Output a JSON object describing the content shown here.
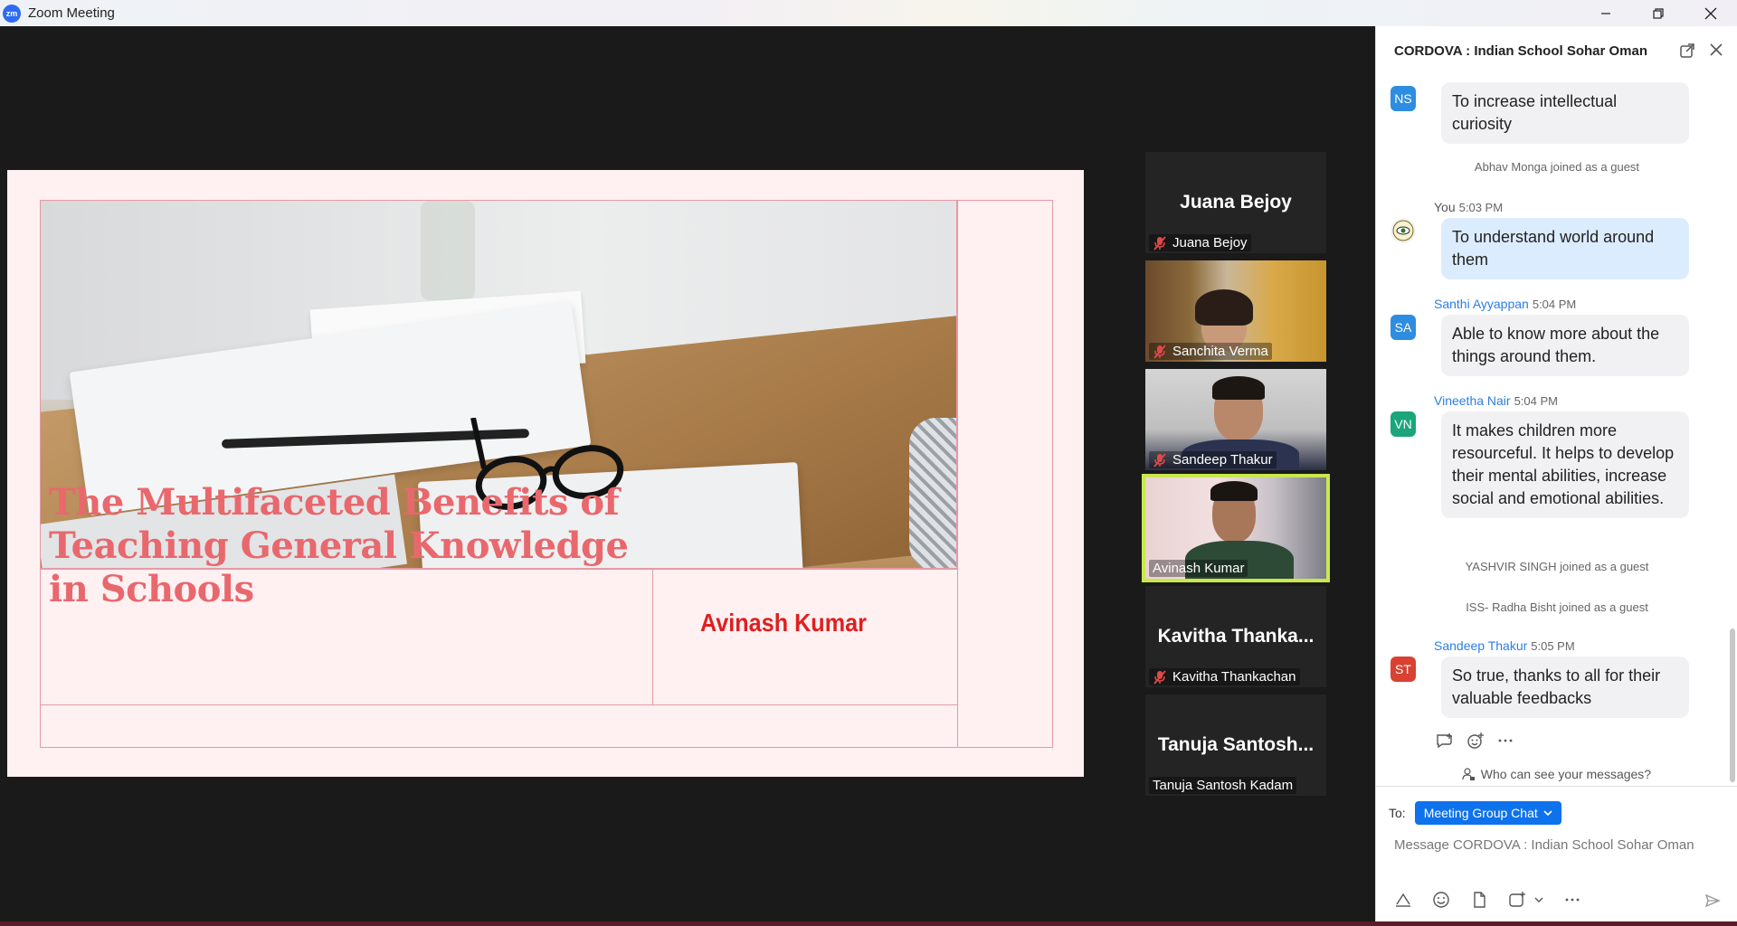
{
  "window": {
    "title": "Zoom Meeting",
    "logo_text": "zm"
  },
  "slide": {
    "title": "The Multifaceted Benefits of Teaching General Knowledge in Schools",
    "author": "Avinash Kumar"
  },
  "participants": [
    {
      "big_name": "Juana Bejoy",
      "label": "Juana Bejoy",
      "muted": true,
      "video": false
    },
    {
      "big_name": "",
      "label": "Sanchita Verma",
      "muted": true,
      "video": true
    },
    {
      "big_name": "",
      "label": "Sandeep Thakur",
      "muted": true,
      "video": true
    },
    {
      "big_name": "",
      "label": "Avinash Kumar",
      "muted": false,
      "video": true,
      "active_speaker": true
    },
    {
      "big_name": "Kavitha  Thanka...",
      "label": "Kavitha Thankachan",
      "muted": true,
      "video": false
    },
    {
      "big_name": "Tanuja  Santosh...",
      "label": "Tanuja Santosh Kadam",
      "muted": false,
      "video": false
    }
  ],
  "chat": {
    "title": "CORDOVA : Indian School Sohar Oman",
    "messages": [
      {
        "initials": "NS",
        "color": "#2d8de0",
        "name": "",
        "time": "",
        "text": "To increase intellectual curiosity"
      },
      {
        "system": "Abhav Monga joined as a guest"
      },
      {
        "initials": "",
        "color": "#f0f0f0",
        "name": "You",
        "time": "5:03 PM",
        "text": "To understand world around them",
        "mine": true
      },
      {
        "initials": "SA",
        "color": "#2d8de0",
        "name": "Santhi Ayyappan",
        "time": "5:04 PM",
        "text": "Able  to know more  about the things around them."
      },
      {
        "initials": "VN",
        "color": "#1aa57a",
        "name": "Vineetha Nair",
        "time": "5:04 PM",
        "text": "It makes children more resourceful. It helps to develop their mental abilities, increase social and emotional abilities."
      },
      {
        "system": "YASHVIR SINGH joined as a guest"
      },
      {
        "system": "ISS- Radha Bisht joined as a guest"
      },
      {
        "initials": "ST",
        "color": "#d94133",
        "name": "Sandeep Thakur",
        "time": "5:05 PM",
        "text": "So true, thanks to all for their valuable feedbacks"
      }
    ],
    "who_can_see": "Who can see your messages?",
    "to_label": "To:",
    "to_target": "Meeting Group Chat",
    "input_placeholder": "Message CORDOVA : Indian School Sohar Oman"
  },
  "colors": {
    "accent": "#0e72ed",
    "slide_title": "#e8686d",
    "slide_author": "#e01f1f",
    "active_speaker_border": "#c8e84f"
  }
}
